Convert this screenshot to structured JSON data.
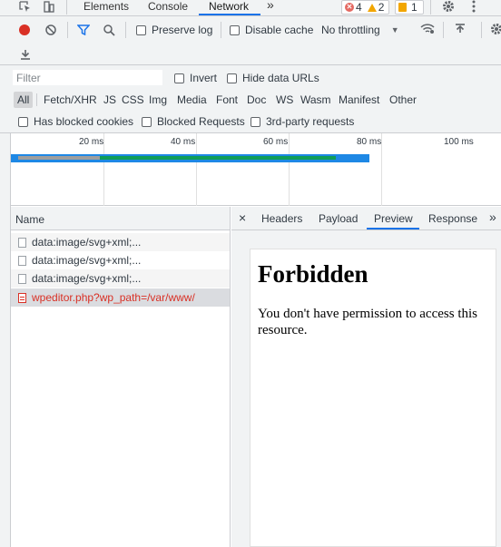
{
  "tabs": [
    {
      "label": "Elements"
    },
    {
      "label": "Console"
    },
    {
      "label": "Network"
    }
  ],
  "more_tabs": "»",
  "status": {
    "errors": "4",
    "warnings": "2",
    "issues": "1"
  },
  "toolbar": {
    "preserve_log": "Preserve log",
    "disable_cache": "Disable cache",
    "throttling": "No throttling"
  },
  "filter": {
    "placeholder": "Filter",
    "invert": "Invert",
    "hide_data_urls": "Hide data URLs",
    "types": [
      "All",
      "Fetch/XHR",
      "JS",
      "CSS",
      "Img",
      "Media",
      "Font",
      "Doc",
      "WS",
      "Wasm",
      "Manifest",
      "Other"
    ],
    "has_blocked_cookies": "Has blocked cookies",
    "blocked_requests": "Blocked Requests",
    "third_party": "3rd-party requests"
  },
  "overview": {
    "ticks": [
      "20 ms",
      "40 ms",
      "60 ms",
      "80 ms",
      "100 ms"
    ]
  },
  "requests": {
    "name_header": "Name",
    "rows": [
      {
        "name": "data:image/svg+xml;..."
      },
      {
        "name": "data:image/svg+xml;..."
      },
      {
        "name": "data:image/svg+xml;..."
      },
      {
        "name": "wpeditor.php?wp_path=/var/www/"
      }
    ]
  },
  "details": {
    "close": "×",
    "tabs": [
      "Headers",
      "Payload",
      "Preview",
      "Response"
    ],
    "more": "»",
    "preview_title": "Forbidden",
    "preview_body": "You don't have permission to access this resource."
  },
  "colors": {
    "accent": "#1a73e8",
    "error": "#d93025",
    "warning": "#f2a600"
  }
}
